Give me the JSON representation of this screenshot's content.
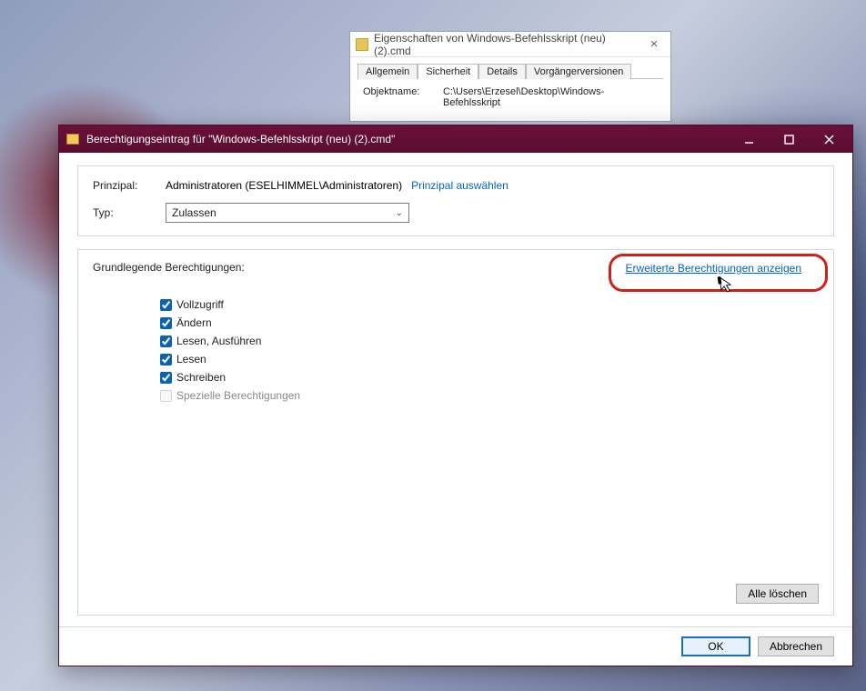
{
  "background_props": {
    "title": "Eigenschaften von Windows-Befehlsskript (neu) (2).cmd",
    "tabs": [
      "Allgemein",
      "Sicherheit",
      "Details",
      "Vorgängerversionen"
    ],
    "active_tab": 1,
    "objektname_label": "Objektname:",
    "objektname_value": "C:\\Users\\Erzesel\\Desktop\\Windows-Befehlsskript"
  },
  "perm_dialog": {
    "title": "Berechtigungseintrag für \"Windows-Befehlsskript (neu) (2).cmd\"",
    "principal_label": "Prinzipal:",
    "principal_value": "Administratoren (ESELHIMMEL\\Administratoren)",
    "select_principal_link": "Prinzipal auswählen",
    "type_label": "Typ:",
    "type_value": "Zulassen",
    "basic_title": "Grundlegende Berechtigungen:",
    "advanced_link": "Erweiterte Berechtigungen anzeigen",
    "permissions": [
      {
        "label": "Vollzugriff",
        "checked": true,
        "enabled": true
      },
      {
        "label": "Ändern",
        "checked": true,
        "enabled": true
      },
      {
        "label": "Lesen, Ausführen",
        "checked": true,
        "enabled": true
      },
      {
        "label": "Lesen",
        "checked": true,
        "enabled": true
      },
      {
        "label": "Schreiben",
        "checked": true,
        "enabled": true
      },
      {
        "label": "Spezielle Berechtigungen",
        "checked": false,
        "enabled": false
      }
    ],
    "clear_all": "Alle löschen",
    "ok": "OK",
    "cancel": "Abbrechen"
  }
}
